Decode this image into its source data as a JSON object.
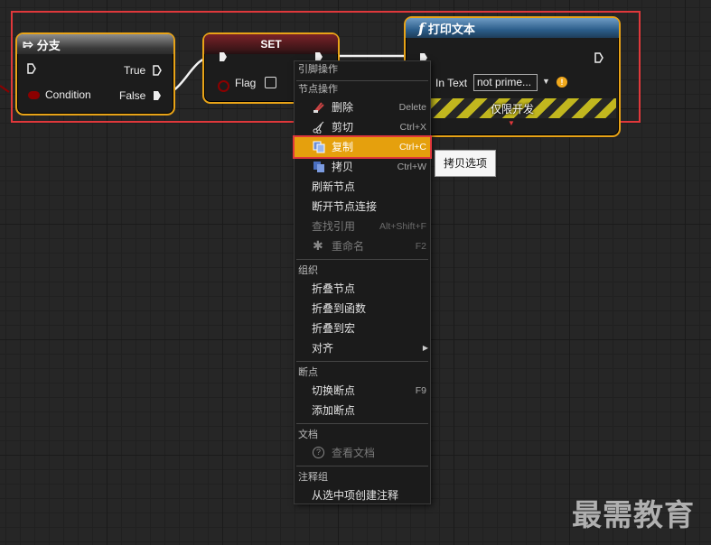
{
  "nodes": {
    "branch": {
      "title": "分支",
      "true_label": "True",
      "condition_label": "Condition",
      "false_label": "False"
    },
    "set": {
      "title": "SET",
      "flag_label": "Flag"
    },
    "print": {
      "title": "打印文本",
      "func_glyph": "f",
      "intext_label": "In Text",
      "intext_value": "not prime...",
      "dev_only": "仅限开发"
    }
  },
  "menu": {
    "header": "引脚操作",
    "sections": {
      "node_ops": "节点操作",
      "organize": "组织",
      "breakpoint": "断点",
      "docs": "文档",
      "comment": "注释组"
    },
    "items": {
      "delete": {
        "label": "删除",
        "shortcut": "Delete"
      },
      "cut": {
        "label": "剪切",
        "shortcut": "Ctrl+X"
      },
      "copy": {
        "label": "复制",
        "shortcut": "Ctrl+C"
      },
      "duplicate": {
        "label": "拷贝",
        "shortcut": "Ctrl+W"
      },
      "refresh": {
        "label": "刷新节点"
      },
      "break_links": {
        "label": "断开节点连接"
      },
      "find_refs": {
        "label": "查找引用",
        "shortcut": "Alt+Shift+F"
      },
      "rename": {
        "label": "重命名",
        "shortcut": "F2"
      },
      "collapse_nodes": {
        "label": "折叠节点"
      },
      "collapse_function": {
        "label": "折叠到函数"
      },
      "collapse_macro": {
        "label": "折叠到宏"
      },
      "align": {
        "label": "对齐"
      },
      "toggle_bp": {
        "label": "切换断点",
        "shortcut": "F9"
      },
      "add_bp": {
        "label": "添加断点"
      },
      "view_docs": {
        "label": "查看文档"
      },
      "create_comment": {
        "label": "从选中项创建注释"
      }
    }
  },
  "tooltip": "拷贝选项",
  "watermark": "最需教育",
  "colors": {
    "selection": "#e8a317",
    "highlight": "#e5a00d",
    "annotation": "#e0383b",
    "bool_pin": "#8b0000",
    "func_header": "#2b5d8a"
  }
}
